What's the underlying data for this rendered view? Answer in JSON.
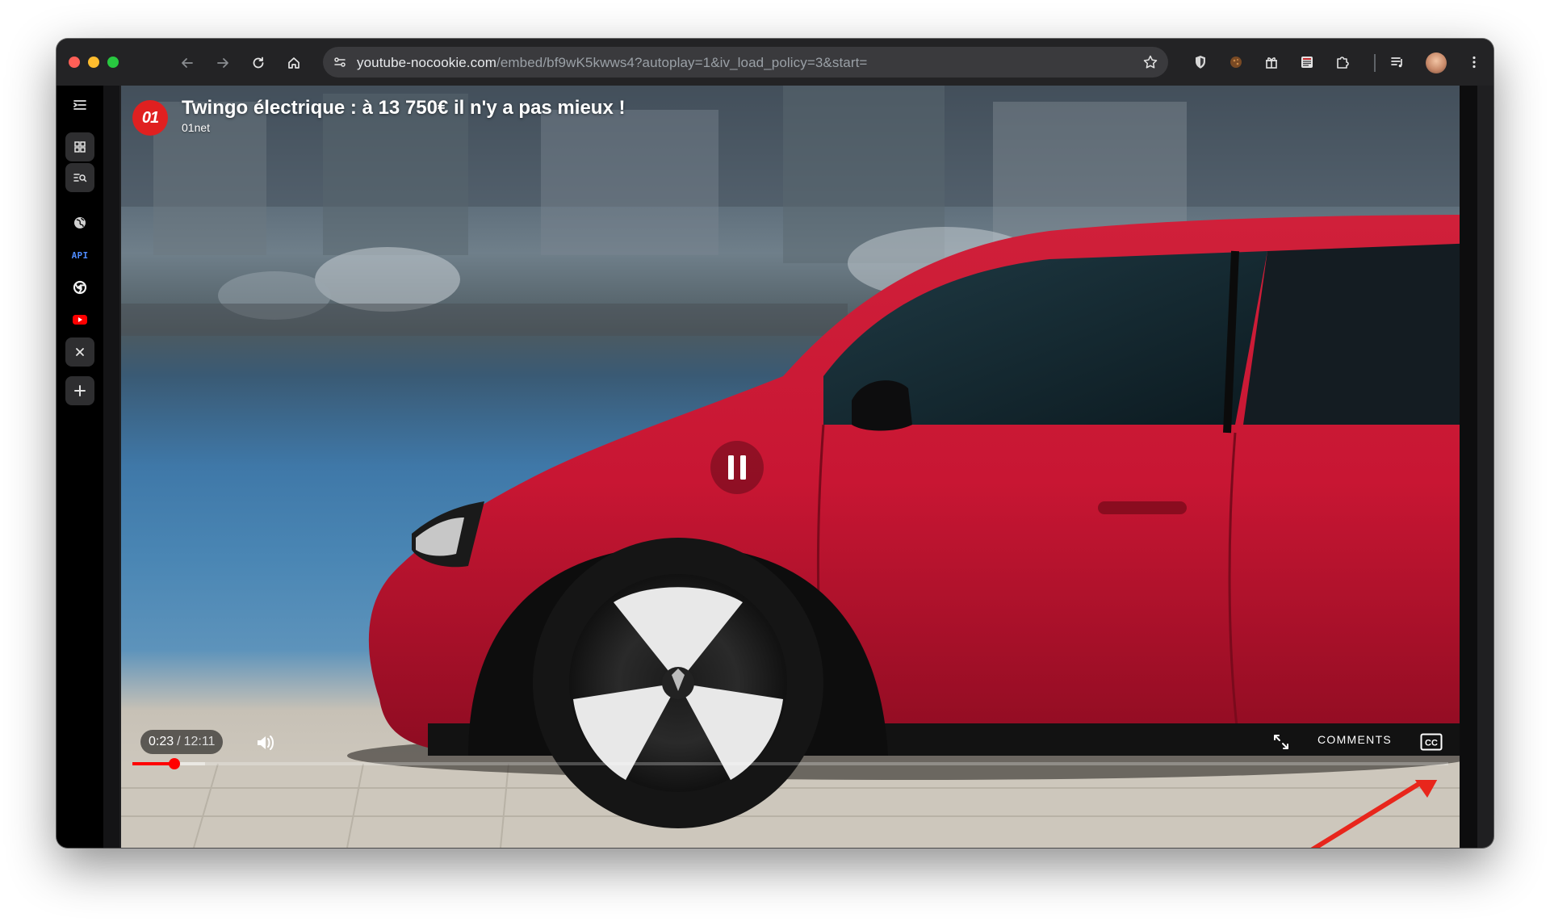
{
  "browser": {
    "url_host": "youtube-nocookie.com",
    "url_path": "/embed/bf9wK5kwws4?autoplay=1&iv_load_policy=3&start=",
    "nav_icons": [
      "back-arrow-icon",
      "forward-arrow-icon",
      "reload-icon",
      "home-icon"
    ],
    "extension_icons": [
      "shield-icon",
      "cookie-icon",
      "gift-icon",
      "reader-icon",
      "puzzle-icon",
      "playlist-icon",
      "menu-dots-icon"
    ]
  },
  "sidebar": {
    "items": [
      {
        "icon": "sidebar-toggle-icon"
      },
      {
        "icon": "grid-icon"
      },
      {
        "icon": "list-search-icon"
      },
      {
        "icon": "globe-icon"
      },
      {
        "label": "API"
      },
      {
        "icon": "chrome-icon"
      },
      {
        "icon": "youtube-icon"
      },
      {
        "icon": "close-icon"
      },
      {
        "icon": "plus-icon"
      }
    ]
  },
  "video": {
    "title": "Twingo électrique : à 13 750€ il n'y a pas mieux !",
    "channel": "01net",
    "channel_logo_text": "01",
    "current_time": "0:23",
    "separator": "/",
    "total_time": "12:11",
    "progress_played": 0.032,
    "progress_loaded": 0.055,
    "comments_label": "COMMENTS",
    "cc_label": "CC"
  },
  "colors": {
    "accent": "#ff0000",
    "annotation_arrow": "#e8261c",
    "channel_logo": "#e02020"
  }
}
